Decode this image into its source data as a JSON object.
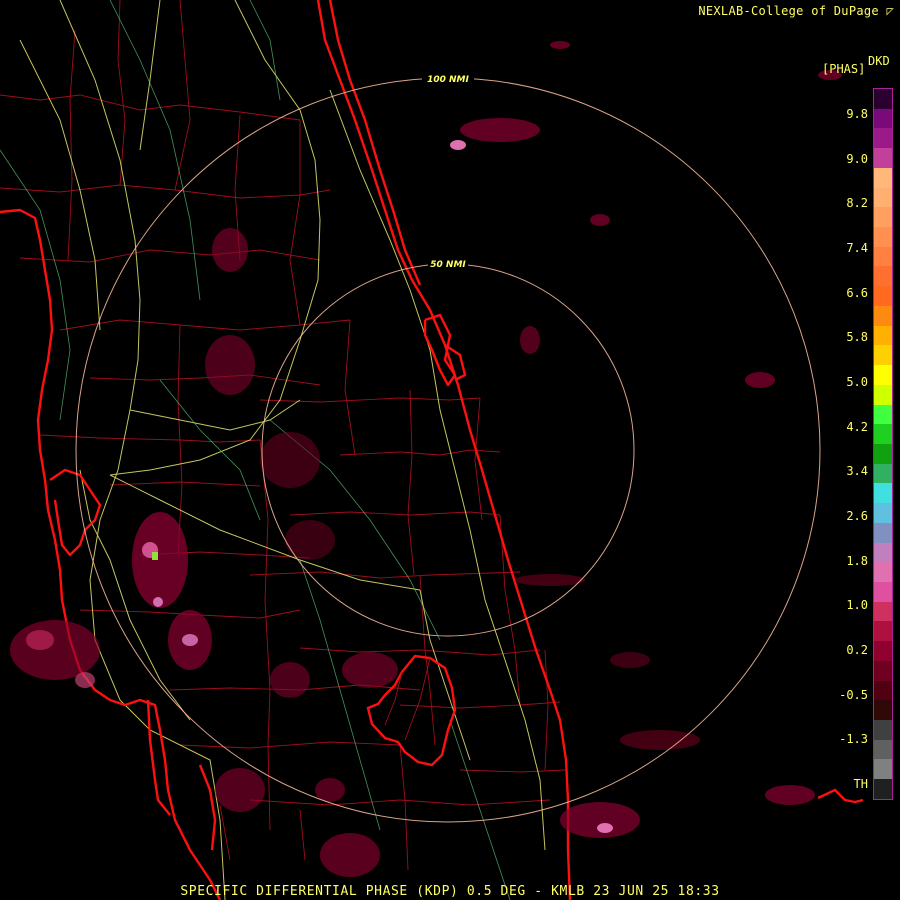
{
  "credit": "NEXLAB-College of DuPage",
  "legend": {
    "unit": "[PHAS]",
    "code": "DKD",
    "ticks": [
      "9.8",
      "9.0",
      "8.2",
      "7.4",
      "6.6",
      "5.8",
      "5.0",
      "4.2",
      "3.4",
      "2.6",
      "1.8",
      "1.0",
      "0.2",
      "-0.5",
      "-1.3",
      "TH"
    ],
    "colors": [
      "#2a0030",
      "#7a0a7a",
      "#9a1a8a",
      "#c0409a",
      "#ffb87a",
      "#ffb070",
      "#ffa060",
      "#ff9050",
      "#ff8040",
      "#ff7030",
      "#ff6a20",
      "#ff8a10",
      "#ffb000",
      "#ffd000",
      "#ffff00",
      "#d0ff00",
      "#40ff40",
      "#20d020",
      "#10a010",
      "#30b060",
      "#40e0e0",
      "#60c0e0",
      "#8090c0",
      "#c080c0",
      "#e070b0",
      "#e050a0",
      "#d03060",
      "#b01040",
      "#900030",
      "#700020",
      "#500010",
      "#300808",
      "#404040",
      "#606060",
      "#808080",
      "#202020"
    ]
  },
  "rings": [
    {
      "label": "100 NMI",
      "range_nmi": 100
    },
    {
      "label": "50 NMI",
      "range_nmi": 50
    }
  ],
  "footer": "SPECIFIC DIFFERENTIAL PHASE (KDP) 0.5 DEG - KMLB 23 JUN 25 18:33"
}
